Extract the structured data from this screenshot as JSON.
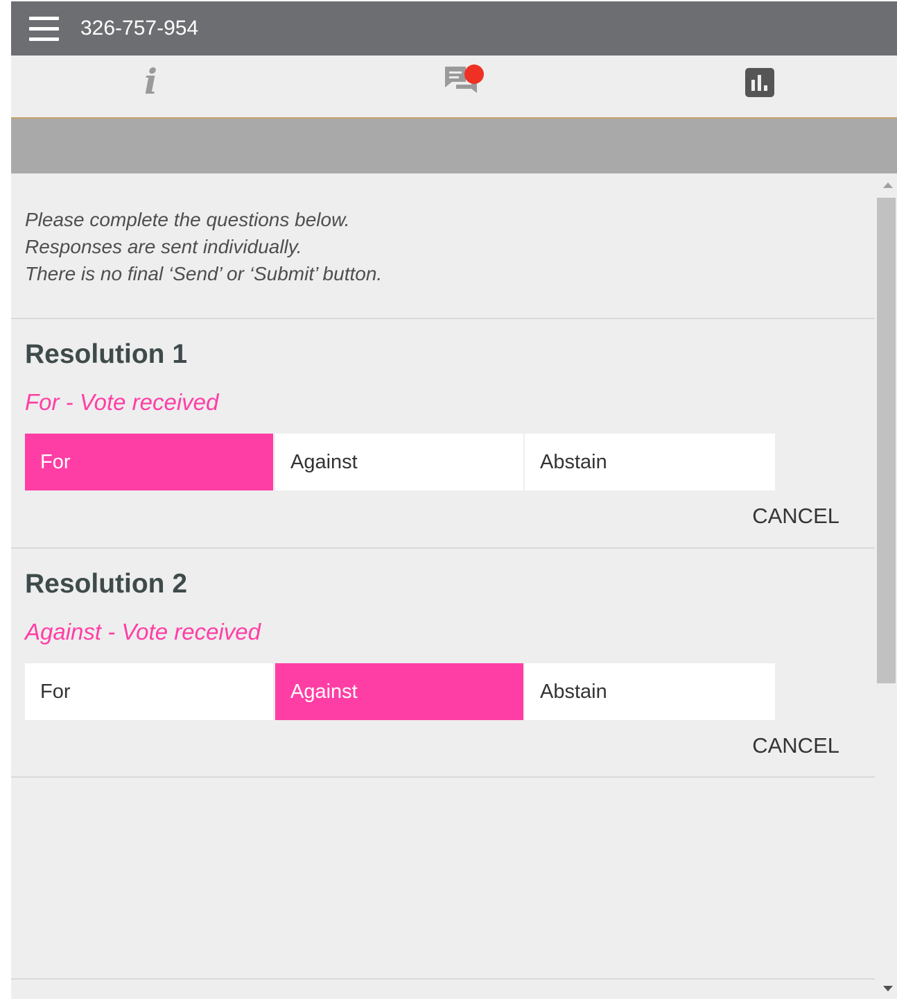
{
  "header": {
    "meeting_id": "326-757-954"
  },
  "tabs": [
    {
      "icon": "info-icon",
      "glyph": "i"
    },
    {
      "icon": "chat-bubbles-icon",
      "badge_color": "#ee3124"
    },
    {
      "icon": "bar-chart-icon"
    }
  ],
  "instructions": [
    "Please complete the questions below.",
    "Responses are sent individually.",
    "There is no final ‘Send’ or ‘Submit’ button."
  ],
  "resolutions": [
    {
      "title": "Resolution 1",
      "status": "For - Vote received",
      "options": [
        "For",
        "Against",
        "Abstain"
      ],
      "selected": "For",
      "cancel_label": "CANCEL"
    },
    {
      "title": "Resolution 2",
      "status": "Against - Vote received",
      "options": [
        "For",
        "Against",
        "Abstain"
      ],
      "selected": "Against",
      "cancel_label": "CANCEL"
    }
  ],
  "colors": {
    "topbar": "#6d6e71",
    "accent": "#ff3ea5",
    "tab_underline": "#c8a36a",
    "band": "#a9a9a9",
    "background": "#eeeeee"
  }
}
